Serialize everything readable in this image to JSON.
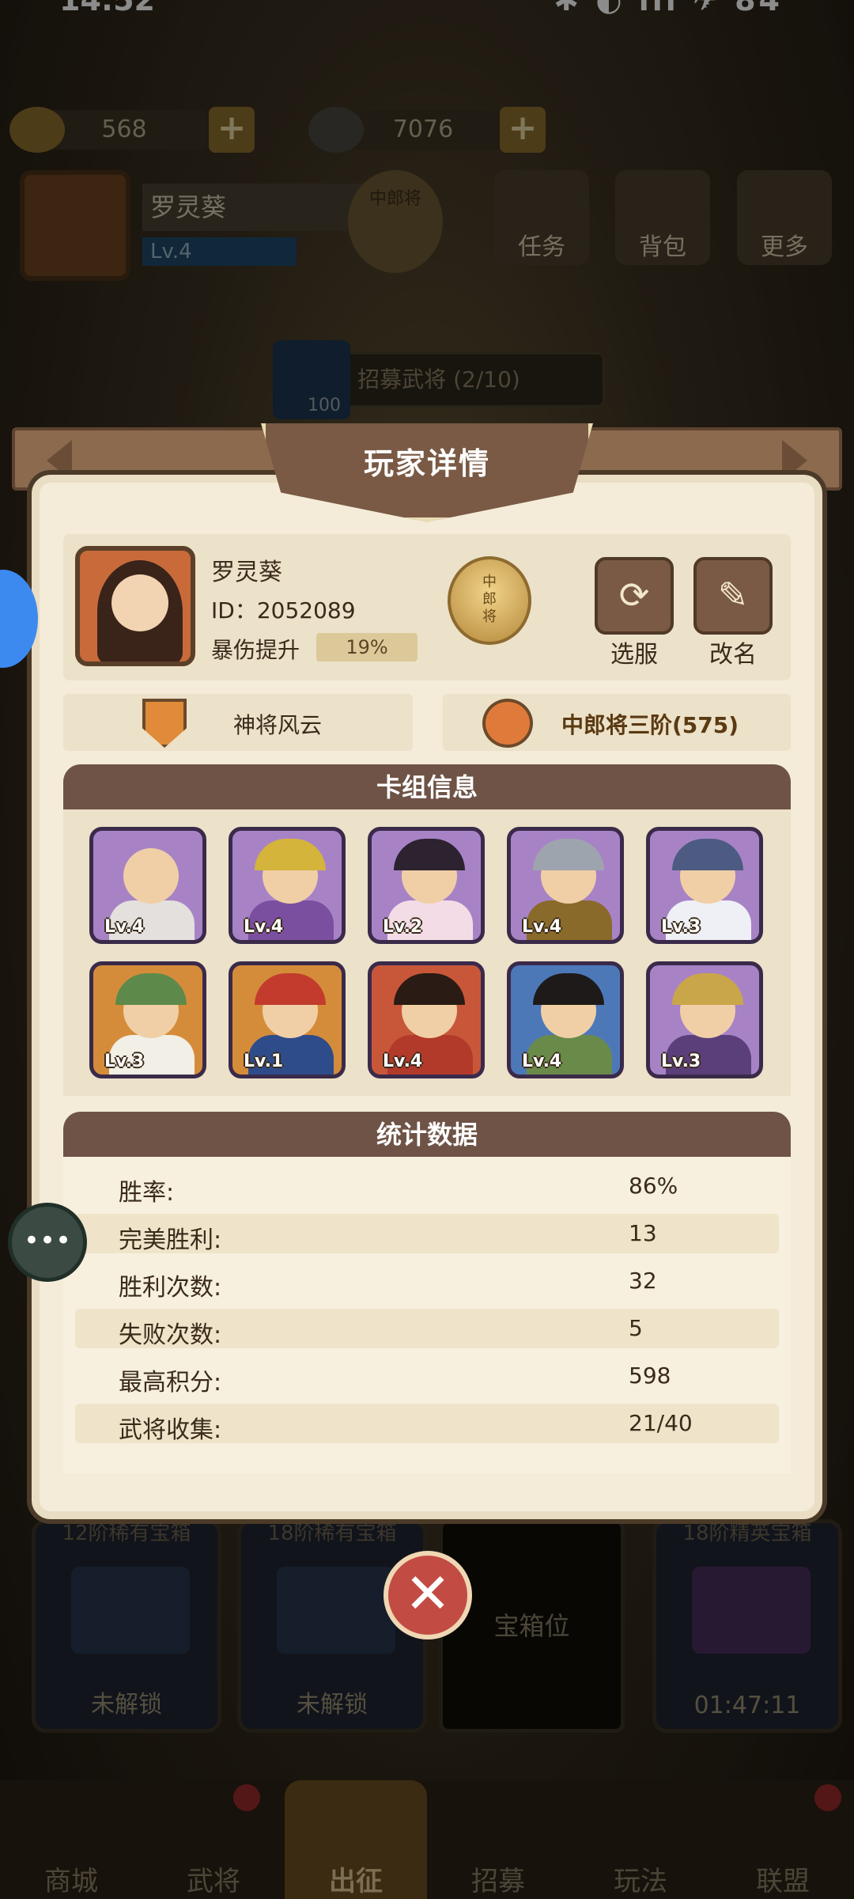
{
  "statusbar": {
    "time": "14:52",
    "icons": "✱ ◐ ıll ✈ 84"
  },
  "resources": {
    "gold": "568",
    "coins": "7076"
  },
  "player_top": {
    "name": "罗灵葵",
    "level": "Lv.4",
    "rank_badge": "中郎将"
  },
  "top_buttons": {
    "tasks": "任务",
    "bag": "背包",
    "more": "更多"
  },
  "recruit": {
    "cost": "100",
    "label": "招募武将",
    "progress": "(2/10)"
  },
  "modal": {
    "title": "玩家详情",
    "profile": {
      "name": "罗灵葵",
      "id": "ID：2052089",
      "crit_label": "暴伤提升",
      "crit_value": "19%",
      "medal": "中郎将",
      "select_server": "选服",
      "rename": "改名"
    },
    "info": {
      "left": "神将风云",
      "right": "中郎将三阶(575)"
    },
    "deck": {
      "title": "卡组信息",
      "cards": [
        {
          "lv": "Lv.4",
          "rarity": "purple"
        },
        {
          "lv": "Lv.4",
          "rarity": "purple"
        },
        {
          "lv": "Lv.2",
          "rarity": "purple"
        },
        {
          "lv": "Lv.4",
          "rarity": "purple"
        },
        {
          "lv": "Lv.3",
          "rarity": "purple"
        },
        {
          "lv": "Lv.3",
          "rarity": "orange"
        },
        {
          "lv": "Lv.1",
          "rarity": "orange"
        },
        {
          "lv": "Lv.4",
          "rarity": "blue"
        },
        {
          "lv": "Lv.4",
          "rarity": "blue"
        },
        {
          "lv": "Lv.3",
          "rarity": "purple"
        }
      ]
    },
    "stats": {
      "title": "统计数据",
      "rows": [
        {
          "label": "胜率:",
          "value": "86%"
        },
        {
          "label": "完美胜利:",
          "value": "13"
        },
        {
          "label": "胜利次数:",
          "value": "32"
        },
        {
          "label": "失败次数:",
          "value": "5"
        },
        {
          "label": "最高积分:",
          "value": "598"
        },
        {
          "label": "武将收集:",
          "value": "21/40"
        }
      ]
    }
  },
  "chests": [
    {
      "caption": "12阶稀有宝箱",
      "label": "未解锁"
    },
    {
      "caption": "18阶稀有宝箱",
      "label": "未解锁"
    },
    {
      "caption": "18阶精英宝箱",
      "label": "01:47:11"
    }
  ],
  "chest_slot": "宝箱位",
  "nav": [
    "商城",
    "武将",
    "出征",
    "招募",
    "玩法",
    "联盟"
  ],
  "icons": {
    "close": "close-icon",
    "chat": "chat-icon",
    "refresh": "refresh-icon",
    "edit": "pencil-icon",
    "plus": "plus-icon"
  },
  "colors": {
    "panel": "#f4ecd9",
    "header": "#6e5346",
    "accent_red": "#c24c44"
  }
}
